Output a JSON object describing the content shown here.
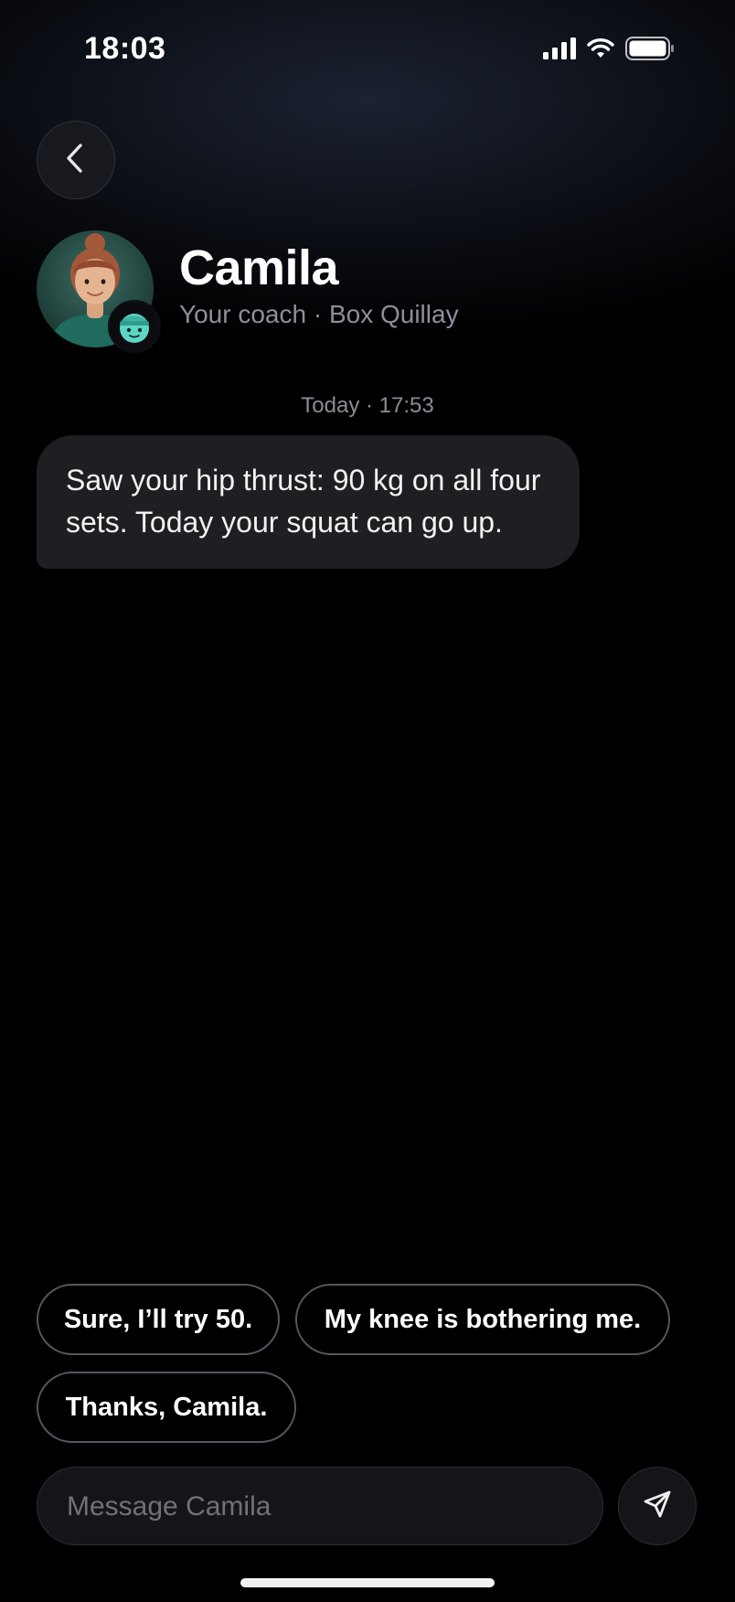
{
  "status_bar": {
    "time": "18:03",
    "icons": [
      "signal-icon",
      "wifi-icon",
      "battery-icon"
    ]
  },
  "header": {
    "back_icon": "chevron-left-icon",
    "coach_name": "Camila",
    "coach_subtitle": "Your coach · Box Quillay",
    "badge_icon": "mascot-badge-icon"
  },
  "conversation": {
    "timestamp": "Today · 17:53",
    "messages": [
      {
        "sender": "Camila",
        "text": "Saw your hip thrust: 90 kg on all four sets. Today your squat can go up."
      }
    ]
  },
  "quick_replies": [
    "Sure, I’ll try 50.",
    "My knee is bothering me.",
    "Thanks, Camila."
  ],
  "composer": {
    "placeholder": "Message Camila",
    "value": "",
    "send_icon": "send-icon"
  },
  "colors": {
    "background": "#000000",
    "bubble": "#1e1f22",
    "subtitle": "#8d9099",
    "chip_border": "#55575d",
    "badge_accent": "#5fd6c4"
  }
}
